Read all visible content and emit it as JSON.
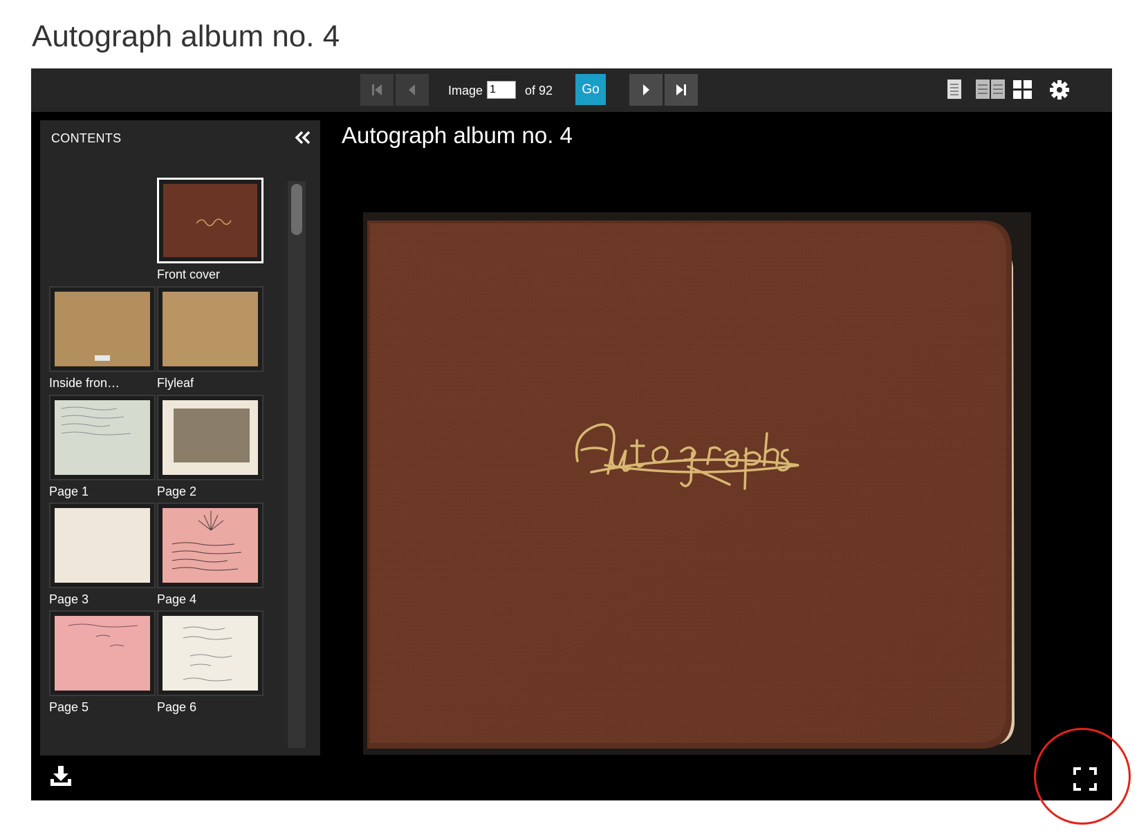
{
  "page": {
    "title": "Autograph album no. 4"
  },
  "toolbar": {
    "image_label": "Image",
    "image_value": "1",
    "of_label": "of 92",
    "go_label": "Go"
  },
  "viewer": {
    "title": "Autograph album no. 4"
  },
  "sidebar": {
    "title": "CONTENTS",
    "items": [
      {
        "label": "Front cover",
        "color": "#6b3525"
      },
      {
        "label": "Inside fron…",
        "color": "#b38f5d"
      },
      {
        "label": "Flyleaf",
        "color": "#b89563"
      },
      {
        "label": "Page 1",
        "color": "#d5dccf"
      },
      {
        "label": "Page 2",
        "color": "#8a7d69"
      },
      {
        "label": "Page 3",
        "color": "#efe7da"
      },
      {
        "label": "Page 4",
        "color": "#eba9a3"
      },
      {
        "label": "Page 5",
        "color": "#eeaaa8"
      },
      {
        "label": "Page 6",
        "color": "#f1ede3"
      }
    ]
  },
  "cover": {
    "script_text": "Autographs",
    "leather_color": "#6e3a26",
    "gold_color": "#d8b873"
  },
  "colors": {
    "go_button": "#1b9ec5",
    "highlight_circle": "#e2231a"
  }
}
